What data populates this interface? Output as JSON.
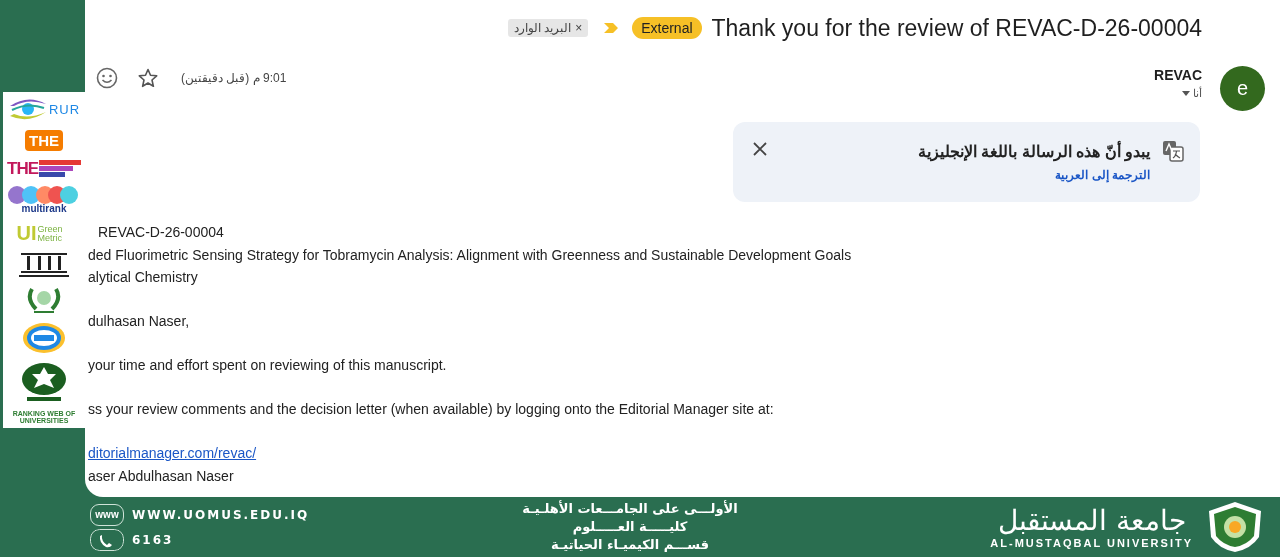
{
  "logos": [
    {
      "kind": "rur",
      "text": "RUR"
    },
    {
      "kind": "the",
      "text": "THE"
    },
    {
      "kind": "the-impact",
      "text": "THE"
    },
    {
      "kind": "multirank",
      "text": "multirank"
    },
    {
      "kind": "greenmetric",
      "text": "UI",
      "sub": "Green Metric"
    },
    {
      "kind": "columns"
    },
    {
      "kind": "wreath"
    },
    {
      "kind": "sdg"
    },
    {
      "kind": "star"
    },
    {
      "kind": "webometrics",
      "text": "RANKING WEB OF UNIVERSITIES"
    }
  ],
  "email": {
    "label_chip": {
      "text": "البريد الوارد",
      "close": "×"
    },
    "badge": "External",
    "subject": "Thank you for the review of REVAC-D-26-00004",
    "sender": "REVAC",
    "recipient": "أنا",
    "avatar": "e",
    "time": "9:01 م (قبل دقيقتين)",
    "translate_bar": {
      "message": "يبدو أنّ هذه الرسالة باللغة الإنجليزية",
      "link": "الترجمة إلى العربية"
    },
    "body": [
      {
        "kind": "text",
        "text": "REVAC-D-26-00004"
      },
      {
        "kind": "text",
        "text": "ded Fluorimetric Sensing Strategy for Tobramycin Analysis: Alignment with Greenness and Sustainable Development Goals"
      },
      {
        "kind": "text",
        "text": "alytical Chemistry"
      },
      {
        "kind": "gap"
      },
      {
        "kind": "text",
        "text": "dulhasan Naser,"
      },
      {
        "kind": "gap"
      },
      {
        "kind": "text",
        "text": "your time and effort spent on reviewing of this manuscript."
      },
      {
        "kind": "gap"
      },
      {
        "kind": "text",
        "text": "ss your review comments and the decision letter (when available) by logging onto the Editorial Manager site at:"
      },
      {
        "kind": "gap"
      },
      {
        "kind": "link",
        "text": "ditorialmanager.com/revac/"
      },
      {
        "kind": "text",
        "text": "aser Abdulhasan Naser"
      }
    ]
  },
  "footer": {
    "website": "WWW.UOMUS.EDU.IQ",
    "www_icon": "www",
    "phone": "6163",
    "lines": [
      "الأولـــى على الجامـــعات الأهلـيـة",
      "كليـــــة العـــــلوم",
      "قســـم الكيميـاء الحياتيـة"
    ],
    "university_ar": "جامعة المستقبل",
    "university_en": "AL-MUSTAQBAL UNIVERSITY"
  }
}
